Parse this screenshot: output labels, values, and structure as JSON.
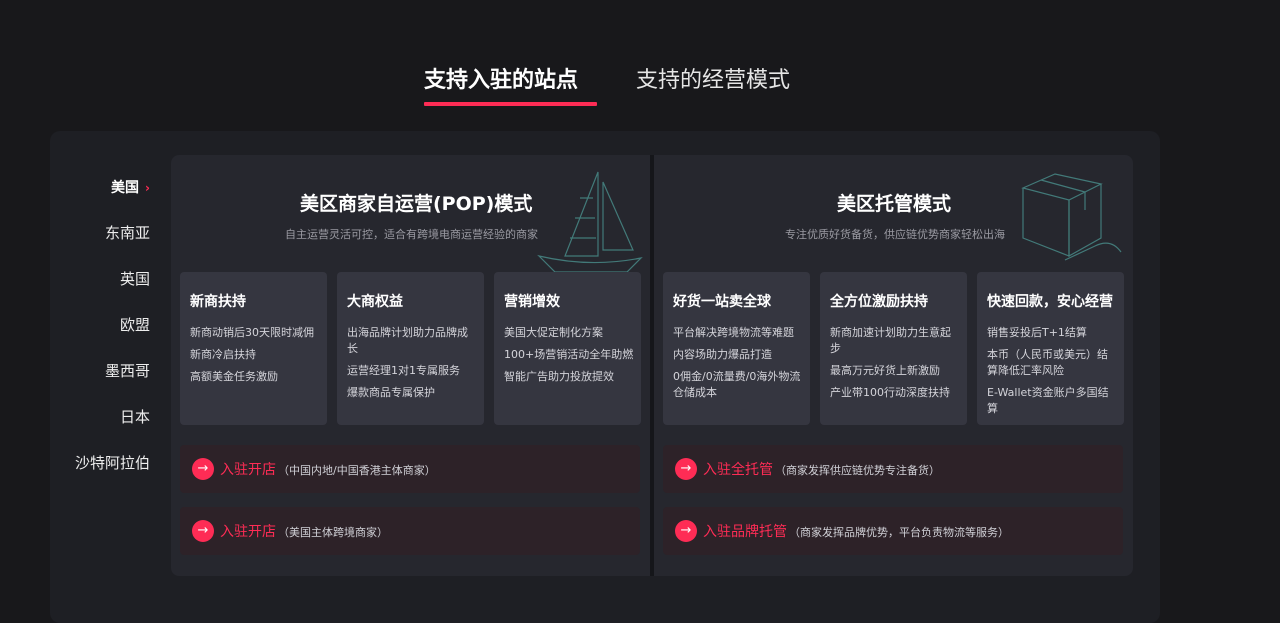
{
  "tabs": {
    "active": "支持入驻的站点",
    "inactive": "支持的经营模式"
  },
  "sidebar": {
    "items": [
      {
        "label": "美国",
        "active": true
      },
      {
        "label": "东南亚"
      },
      {
        "label": "英国"
      },
      {
        "label": "欧盟"
      },
      {
        "label": "墨西哥"
      },
      {
        "label": "日本"
      },
      {
        "label": "沙特阿拉伯"
      }
    ],
    "active_marker": "›"
  },
  "pop": {
    "title": "美区商家自运营(POP)模式",
    "subtitle": "自主运营灵活可控，适合有跨境电商运营经验的商家",
    "features": [
      {
        "title": "新商扶持",
        "lines": [
          "新商动销后30天限时减佣",
          "新商冷启扶持",
          "高额美金任务激励"
        ]
      },
      {
        "title": "大商权益",
        "lines": [
          "出海品牌计划助力品牌成长",
          "运营经理1对1专属服务",
          "爆款商品专属保护"
        ]
      },
      {
        "title": "营销增效",
        "lines": [
          "美国大促定制化方案",
          "100+场营销活动全年助燃",
          "智能广告助力投放提效"
        ]
      }
    ],
    "ctas": [
      {
        "label": "入驻开店",
        "note": "（中国内地/中国香港主体商家）"
      },
      {
        "label": "入驻开店",
        "note": "（美国主体跨境商家）"
      }
    ]
  },
  "managed": {
    "title": "美区托管模式",
    "subtitle": "专注优质好货备货，供应链优势商家轻松出海",
    "features": [
      {
        "title": "好货一站卖全球",
        "lines": [
          "平台解决跨境物流等难题",
          "内容场助力爆品打造",
          "0佣金/0流量费/0海外物流仓储成本"
        ]
      },
      {
        "title": "全方位激励扶持",
        "lines": [
          "新商加速计划助力生意起步",
          "最高万元好货上新激励",
          "产业带100行动深度扶持"
        ]
      },
      {
        "title": "快速回款，安心经营",
        "lines": [
          "销售妥投后T+1结算",
          "本币（人民币或美元）结算降低汇率风险",
          "E-Wallet资金账户多国结算"
        ]
      }
    ],
    "ctas": [
      {
        "label": "入驻全托管",
        "note": "（商家发挥供应链优势专注备货）"
      },
      {
        "label": "入驻品牌托管",
        "note": "（商家发挥品牌优势，平台负责物流等服务）"
      }
    ]
  },
  "icons": {
    "arrow": "→",
    "left_decoration": "sailboat-icon",
    "right_decoration": "package-box-icon"
  },
  "colors": {
    "accent": "#fe2c55",
    "background": "#18181b",
    "panel": "#1e1f24",
    "card": "#26272e",
    "feature": "#353640"
  }
}
